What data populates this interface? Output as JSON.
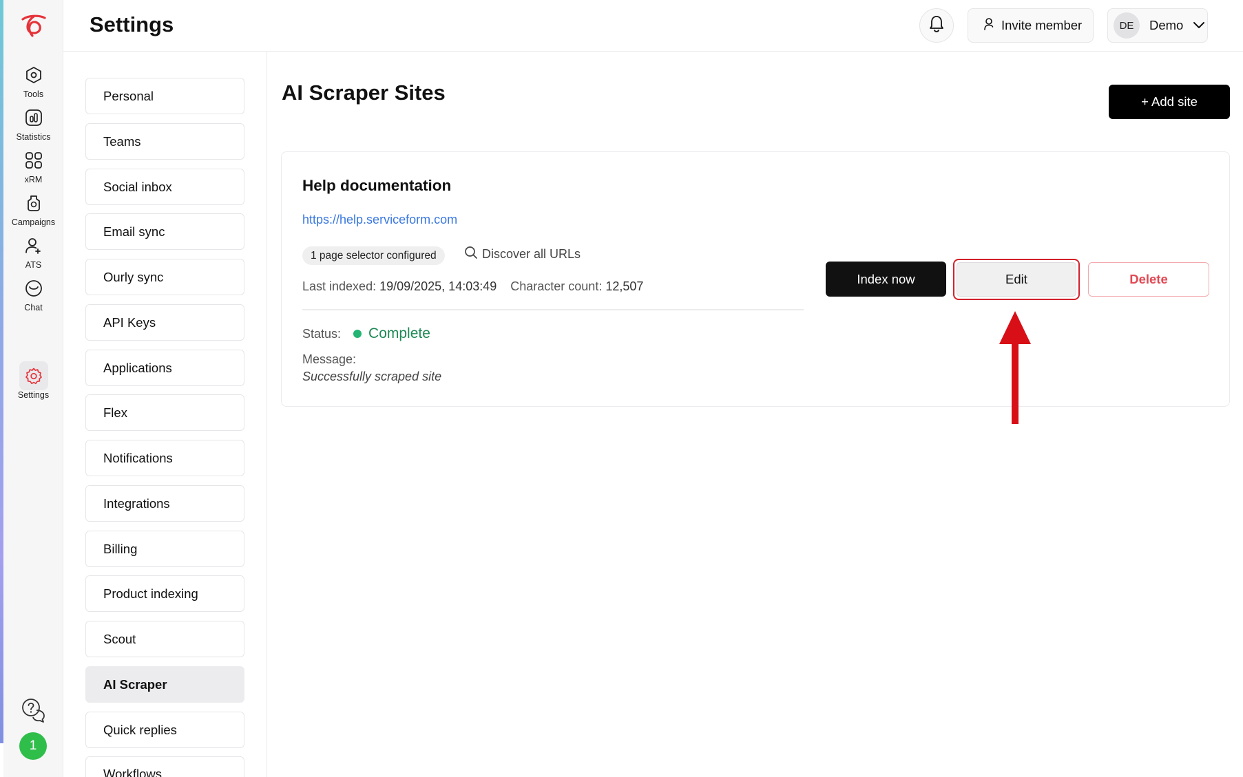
{
  "app": {
    "page_title": "Settings",
    "accent_color": "#e5333a"
  },
  "rail": {
    "items": [
      {
        "label": "Tools",
        "icon": "hexagon-icon"
      },
      {
        "label": "Statistics",
        "icon": "chart-icon"
      },
      {
        "label": "xRM",
        "icon": "grid-icon"
      },
      {
        "label": "Campaigns",
        "icon": "campaign-icon"
      },
      {
        "label": "ATS",
        "icon": "user-add-icon"
      },
      {
        "label": "Chat",
        "icon": "chat-icon"
      },
      {
        "label": "Settings",
        "icon": "gear-icon",
        "active": true
      }
    ],
    "notification_count": "1"
  },
  "header": {
    "invite_label": "Invite member",
    "user_initials": "DE",
    "user_name": "Demo"
  },
  "settings_nav": {
    "items": [
      {
        "label": "Personal"
      },
      {
        "label": "Teams"
      },
      {
        "label": "Social inbox"
      },
      {
        "label": "Email sync"
      },
      {
        "label": "Ourly sync"
      },
      {
        "label": "API Keys"
      },
      {
        "label": "Applications"
      },
      {
        "label": "Flex"
      },
      {
        "label": "Notifications"
      },
      {
        "label": "Integrations"
      },
      {
        "label": "Billing"
      },
      {
        "label": "Product indexing"
      },
      {
        "label": "Scout"
      },
      {
        "label": "AI Scraper",
        "active": true
      },
      {
        "label": "Quick replies"
      },
      {
        "label": "Workflows"
      }
    ]
  },
  "main": {
    "title": "AI Scraper Sites",
    "add_site_label": "+ Add site",
    "site": {
      "name": "Help documentation",
      "url": "https://help.serviceform.com",
      "selector_badge": "1 page selector configured",
      "discover_label": "Discover all URLs",
      "last_indexed_label": "Last indexed:",
      "last_indexed_value": "19/09/2025, 14:03:49",
      "char_count_label": "Character count:",
      "char_count_value": "12,507",
      "status_label": "Status:",
      "status_value": "Complete",
      "status_color": "#22b573",
      "message_label": "Message:",
      "message_value": "Successfully scraped site",
      "index_now_label": "Index now",
      "edit_label": "Edit",
      "delete_label": "Delete"
    }
  },
  "annotation": {
    "highlight_color": "#d3202b",
    "arrow_icon": "up-arrow-icon"
  }
}
